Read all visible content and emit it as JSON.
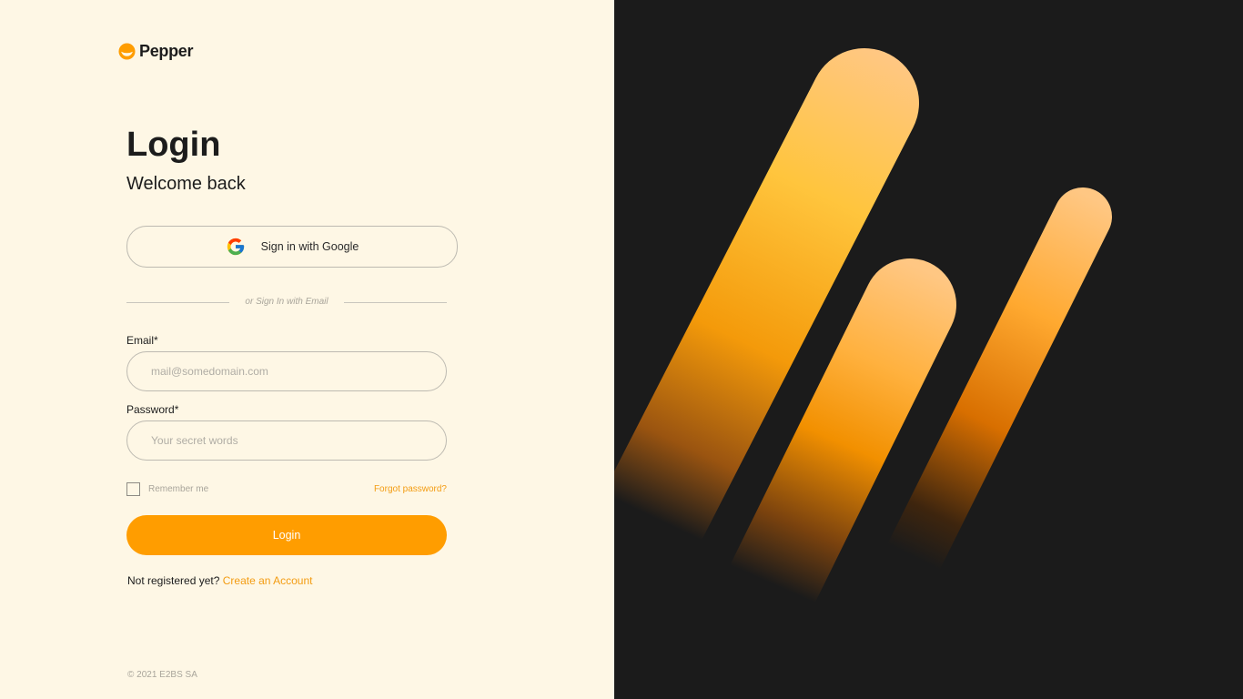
{
  "brand": {
    "name": "Pepper",
    "icon": "pepper-logo-icon",
    "color": "#ff9d00"
  },
  "header": {
    "title": "Login",
    "subtitle": "Welcome back"
  },
  "google": {
    "label": "Sign in with Google",
    "icon": "google-icon"
  },
  "divider": {
    "text": "or Sign In with Email"
  },
  "form": {
    "email": {
      "label": "Email*",
      "placeholder": "mail@somedomain.com",
      "value": ""
    },
    "password": {
      "label": "Password*",
      "placeholder": "Your secret words",
      "value": ""
    },
    "remember": {
      "label": "Remember me",
      "checked": false
    },
    "forgot_label": "Forgot password?",
    "submit_label": "Login"
  },
  "register": {
    "prompt": "Not registered yet?",
    "link_label": "Create an Account"
  },
  "footer": {
    "copyright": "© 2021 E2BS SA"
  },
  "colors": {
    "left_background": "#fef7e5",
    "right_background": "#1b1b1b",
    "accent": "#ff9d00",
    "link": "#f39c12"
  }
}
